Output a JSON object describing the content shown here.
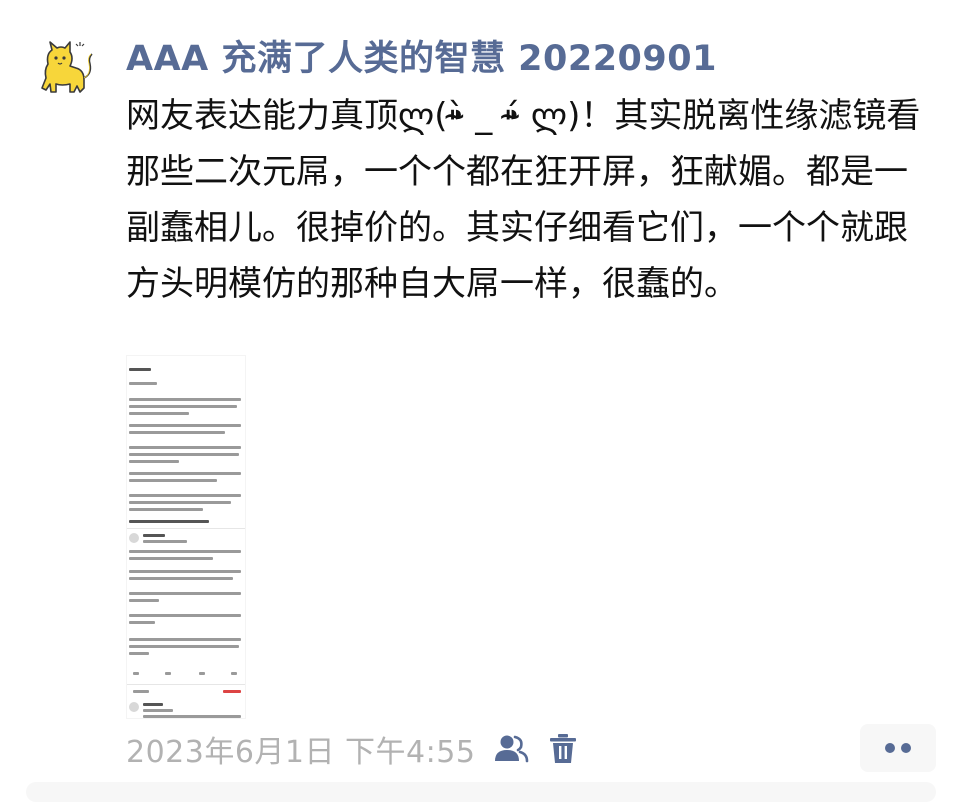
{
  "post": {
    "nickname": "AAA 充满了人类的智慧 20220901",
    "content": "网友表达能力真顶ლ(⁍̴̀ _ ⁍̴́ ლ)！其实脱离性缘滤镜看那些二次元屌，一个个都在狂开屏，狂献媚。都是一副蠢相儿。很掉价的。其实仔细看它们，一个个就跟方头明模仿的那种自大屌一样，很蠢的。",
    "timestamp": "2023年6月1日 下午4:55",
    "icons": {
      "avatar": "yellow-cat-avatar",
      "visibility": "people-icon",
      "delete": "trash-icon",
      "more": "more-dots-icon"
    },
    "colors": {
      "nickname": "#576b95",
      "timestamp": "#b2b2b2",
      "icon": "#576b95"
    }
  }
}
